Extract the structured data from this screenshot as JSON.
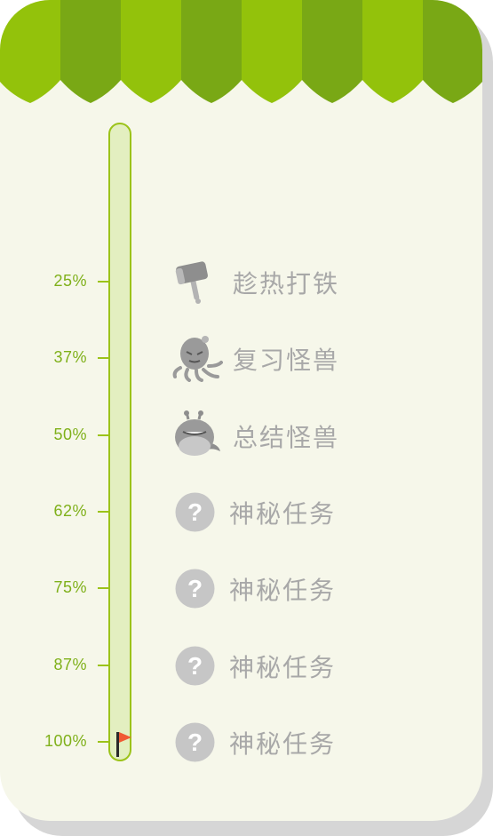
{
  "progress": {
    "levels": [
      {
        "pct": "25%",
        "task": "趁热打铁",
        "icon": "hammer-icon"
      },
      {
        "pct": "37%",
        "task": "复习怪兽",
        "icon": "octopus-monster-icon"
      },
      {
        "pct": "50%",
        "task": "总结怪兽",
        "icon": "crab-monster-icon"
      },
      {
        "pct": "62%",
        "task": "神秘任务",
        "icon": "question-mark-icon"
      },
      {
        "pct": "75%",
        "task": "神秘任务",
        "icon": "question-mark-icon"
      },
      {
        "pct": "87%",
        "task": "神秘任务",
        "icon": "question-mark-icon"
      },
      {
        "pct": "100%",
        "task": "神秘任务",
        "icon": "question-mark-icon"
      }
    ],
    "current_fill": 0
  },
  "colors": {
    "awning_light": "#93c20b",
    "awning_dark": "#79a815",
    "accent_green": "#9cc31a",
    "background": "#f6f7ea",
    "text_gray": "#a8a8a8",
    "flag_red": "#f05a33"
  }
}
